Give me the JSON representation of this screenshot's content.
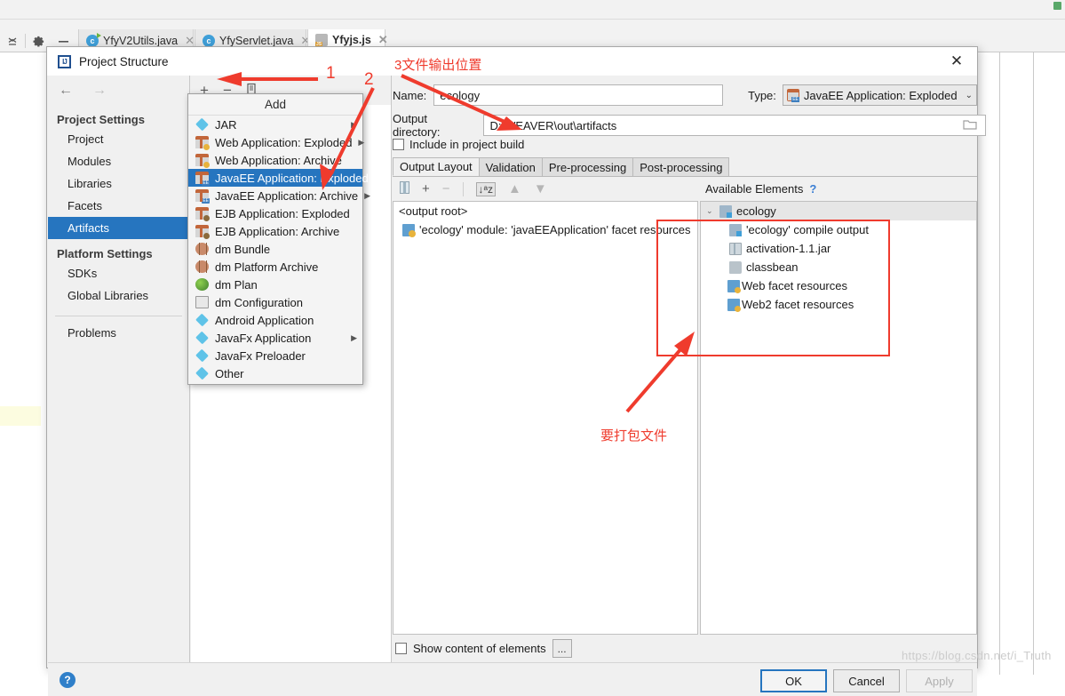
{
  "ide": {
    "left_icons": [
      "collapse-all-icon",
      "settings-gear-icon",
      "minimize-icon"
    ],
    "tabs": [
      {
        "label": "YfyV2Utils.java",
        "icon": "java-run-icon",
        "active": false
      },
      {
        "label": "YfyServlet.java",
        "icon": "java-class-icon",
        "active": false
      },
      {
        "label": "Yfyjs.js",
        "icon": "javascript-file-icon",
        "active": true
      }
    ]
  },
  "dialog": {
    "title": "Project Structure",
    "close_label": "✕",
    "nav": {
      "back": "←",
      "forward": "→"
    },
    "sidebar": {
      "groups": [
        {
          "title": "Project Settings",
          "items": [
            {
              "label": "Project",
              "selected": false
            },
            {
              "label": "Modules",
              "selected": false
            },
            {
              "label": "Libraries",
              "selected": false
            },
            {
              "label": "Facets",
              "selected": false
            },
            {
              "label": "Artifacts",
              "selected": true
            }
          ]
        },
        {
          "title": "Platform Settings",
          "items": [
            {
              "label": "SDKs",
              "selected": false
            },
            {
              "label": "Global Libraries",
              "selected": false
            }
          ]
        }
      ],
      "problems": "Problems"
    },
    "artifacts_toolbar": {
      "add": "+",
      "remove": "−",
      "copy": "copy-icon"
    },
    "detail": {
      "name_label": "Name:",
      "name_value": "ecology",
      "type_label": "Type:",
      "type_value": "JavaEE Application: Exploded",
      "output_dir_label": "Output directory:",
      "output_dir_value": "D:\\WEAVER\\out\\artifacts",
      "include_in_build_label": "Include in project build",
      "include_in_build_checked": false,
      "tabs": [
        {
          "label": "Output Layout",
          "active": true
        },
        {
          "label": "Validation",
          "active": false
        },
        {
          "label": "Pre-processing",
          "active": false
        },
        {
          "label": "Post-processing",
          "active": false
        }
      ],
      "layout_toolbar": {
        "jar_icon": "jar-icon",
        "add_icon": "+",
        "remove_icon": "−",
        "sort_icon": "sort-az-icon",
        "up_icon": "▲",
        "down_icon": "▼"
      },
      "output_tree": {
        "root": "<output root>",
        "children": [
          {
            "label": "'ecology' module: 'javaEEApplication' facet resources",
            "icon": "facet-resources-icon"
          }
        ]
      },
      "available_elements": {
        "header": "Available Elements",
        "help": "?",
        "root": {
          "label": "ecology",
          "icon": "module-icon",
          "expanded": true
        },
        "children": [
          {
            "label": "'ecology' compile output",
            "icon": "compile-output-icon"
          },
          {
            "label": "activation-1.1.jar",
            "icon": "jar-icon"
          },
          {
            "label": "classbean",
            "icon": "folder-icon"
          },
          {
            "label": "Web facet resources",
            "icon": "web-facet-icon"
          },
          {
            "label": "Web2 facet resources",
            "icon": "web-facet-icon"
          }
        ]
      },
      "show_content_label": "Show content of elements",
      "show_content_checked": false,
      "dots_button": "..."
    },
    "footer": {
      "help": "?",
      "ok": "OK",
      "cancel": "Cancel",
      "apply": "Apply"
    }
  },
  "add_menu": {
    "title": "Add",
    "items": [
      {
        "label": "JAR",
        "icon": "jar-diamond-icon",
        "submenu": true,
        "selected": false
      },
      {
        "label": "Web Application: Exploded",
        "icon": "web-app-icon",
        "submenu": true,
        "selected": false
      },
      {
        "label": "Web Application: Archive",
        "icon": "web-app-icon",
        "submenu": false,
        "selected": false
      },
      {
        "label": "JavaEE Application: Exploded",
        "icon": "javaee-app-icon",
        "submenu": false,
        "selected": true
      },
      {
        "label": "JavaEE Application: Archive",
        "icon": "javaee-app-icon",
        "submenu": true,
        "selected": false
      },
      {
        "label": "EJB Application: Exploded",
        "icon": "ejb-app-icon",
        "submenu": false,
        "selected": false
      },
      {
        "label": "EJB Application: Archive",
        "icon": "ejb-app-icon",
        "submenu": false,
        "selected": false
      },
      {
        "label": "dm Bundle",
        "icon": "dm-bundle-icon",
        "submenu": false,
        "selected": false
      },
      {
        "label": "dm Platform Archive",
        "icon": "dm-platform-icon",
        "submenu": false,
        "selected": false
      },
      {
        "label": "dm Plan",
        "icon": "dm-plan-icon",
        "submenu": false,
        "selected": false
      },
      {
        "label": "dm Configuration",
        "icon": "dm-config-icon",
        "submenu": false,
        "selected": false
      },
      {
        "label": "Android Application",
        "icon": "android-app-icon",
        "submenu": false,
        "selected": false
      },
      {
        "label": "JavaFx Application",
        "icon": "javafx-app-icon",
        "submenu": true,
        "selected": false
      },
      {
        "label": "JavaFx Preloader",
        "icon": "javafx-preloader-icon",
        "submenu": false,
        "selected": false
      },
      {
        "label": "Other",
        "icon": "other-icon",
        "submenu": false,
        "selected": false
      }
    ]
  },
  "annotations": {
    "num1": "1",
    "num2": "2",
    "label_output": "3文件输出位置",
    "label_package": "要打包文件"
  },
  "watermark": "https://blog.csdn.net/i_Truth"
}
